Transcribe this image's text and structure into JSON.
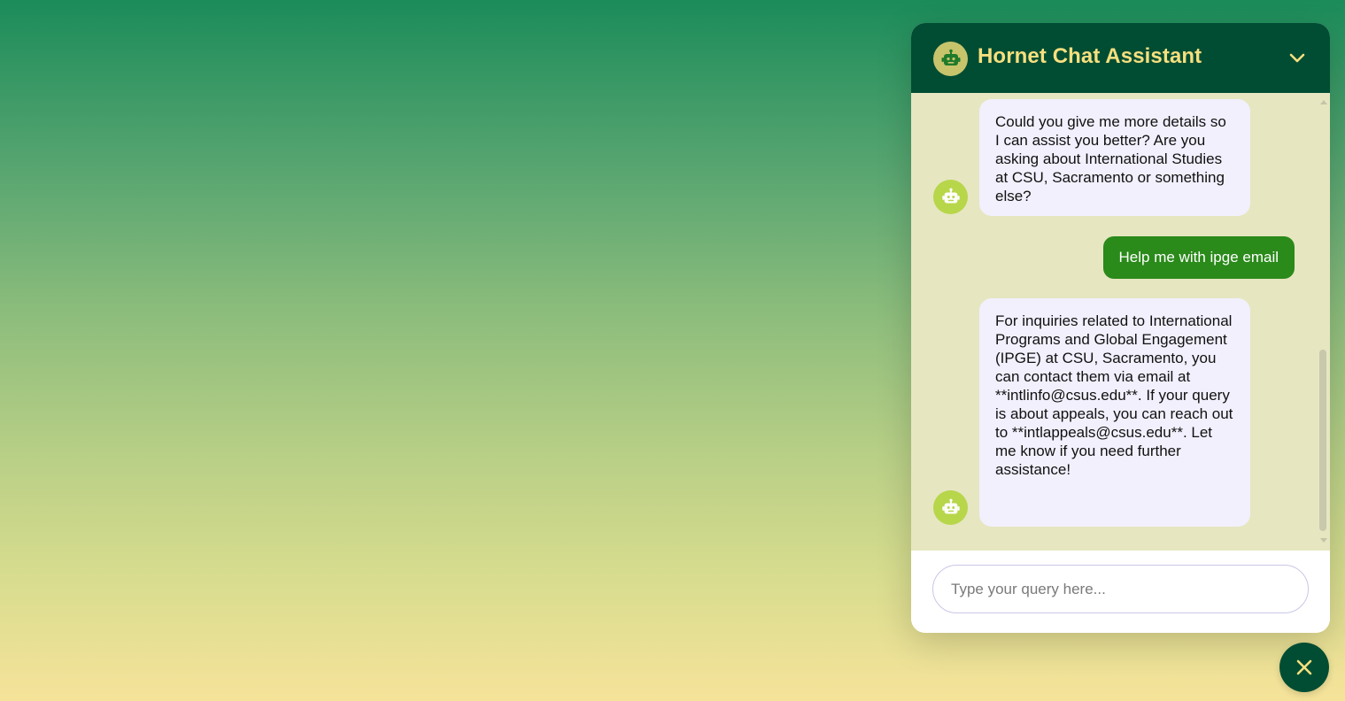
{
  "chat": {
    "title": "Hornet Chat Assistant",
    "header_icon": "robot-icon",
    "collapse_icon": "chevron-down-icon",
    "messages": [
      {
        "sender": "bot",
        "text": "Could you give me more details so I can assist you better? Are you asking about International Studies at CSU, Sacramento or something else?"
      },
      {
        "sender": "user",
        "text": "Help me with ipge email"
      },
      {
        "sender": "bot",
        "text": "For inquiries related to International Programs and Global Engagement (IPGE) at CSU, Sacramento, you can contact them via email at **intlinfo@csus.edu**. If your query is about appeals, you can reach out to **intlappeals@csus.edu**. Let me know if you need further assistance!"
      }
    ],
    "input": {
      "placeholder": "Type your query here...",
      "value": ""
    },
    "close_icon": "close-icon"
  },
  "colors": {
    "header_bg": "#004d33",
    "title_color": "#f7df7f",
    "chat_body_bg": "#e6e6c1",
    "bot_bubble_bg": "#f2f0fd",
    "user_bubble_bg": "#2a8a1a",
    "bot_avatar_bg": "#b7d64a",
    "gradient_top": "#1b8c5a",
    "gradient_bottom": "#f6e39a"
  }
}
